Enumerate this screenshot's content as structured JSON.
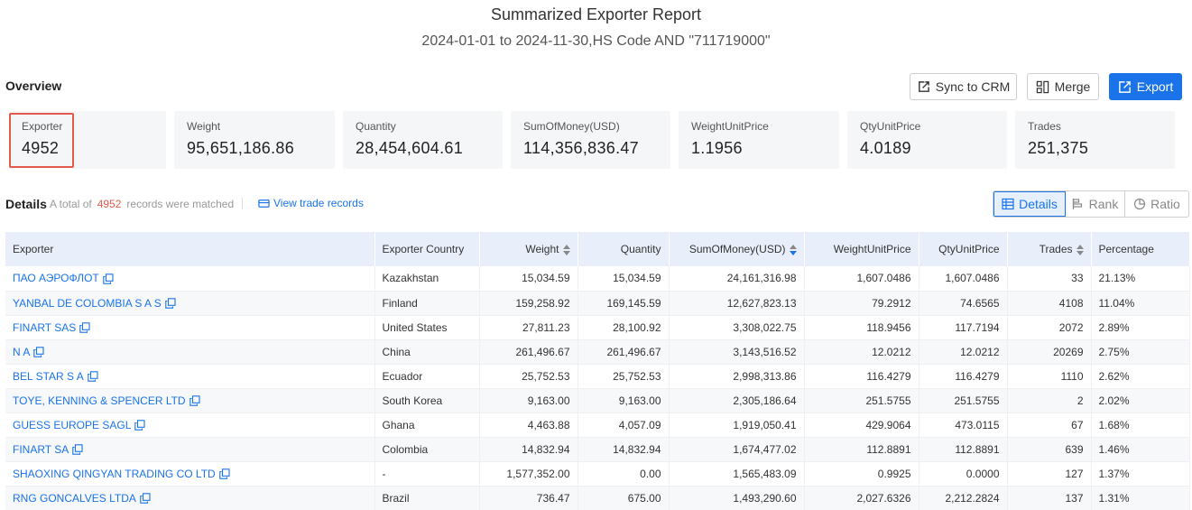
{
  "header": {
    "title": "Summarized Exporter Report",
    "subtitle": "2024-01-01 to 2024-11-30,HS Code AND \"711719000\""
  },
  "overview": {
    "label": "Overview",
    "buttons": {
      "sync": "Sync to CRM",
      "merge": "Merge",
      "export": "Export"
    },
    "stats": [
      {
        "label": "Exporter",
        "value": "4952"
      },
      {
        "label": "Weight",
        "value": "95,651,186.86"
      },
      {
        "label": "Quantity",
        "value": "28,454,604.61"
      },
      {
        "label": "SumOfMoney(USD)",
        "value": "114,356,836.47"
      },
      {
        "label": "WeightUnitPrice",
        "value": "1.1956"
      },
      {
        "label": "QtyUnitPrice",
        "value": "4.0189"
      },
      {
        "label": "Trades",
        "value": "251,375"
      }
    ]
  },
  "details": {
    "label": "Details",
    "meta_prefix": "A total of",
    "count": "4952",
    "meta_suffix": "records were matched",
    "view_link": "View trade records",
    "views": {
      "details": "Details",
      "rank": "Rank",
      "ratio": "Ratio"
    }
  },
  "table": {
    "columns": [
      "Exporter",
      "Exporter Country",
      "Weight",
      "Quantity",
      "SumOfMoney(USD)",
      "WeightUnitPrice",
      "QtyUnitPrice",
      "Trades",
      "Percentage"
    ],
    "rows": [
      [
        "ПАО АЭРОФЛОТ",
        "Kazakhstan",
        "15,034.59",
        "15,034.59",
        "24,161,316.98",
        "1,607.0486",
        "1,607.0486",
        "33",
        "21.13%"
      ],
      [
        "YANBAL DE COLOMBIA S A S",
        "Finland",
        "159,258.92",
        "169,145.59",
        "12,627,823.13",
        "79.2912",
        "74.6565",
        "4108",
        "11.04%"
      ],
      [
        "FINART SAS",
        "United States",
        "27,811.23",
        "28,100.92",
        "3,308,022.75",
        "118.9456",
        "117.7194",
        "2072",
        "2.89%"
      ],
      [
        "N A",
        "China",
        "261,496.67",
        "261,496.67",
        "3,143,516.52",
        "12.0212",
        "12.0212",
        "20269",
        "2.75%"
      ],
      [
        "BEL STAR S A",
        "Ecuador",
        "25,752.53",
        "25,752.53",
        "2,998,313.86",
        "116.4279",
        "116.4279",
        "1110",
        "2.62%"
      ],
      [
        "TOYE, KENNING & SPENCER LTD",
        "South Korea",
        "9,163.00",
        "9,163.00",
        "2,305,186.64",
        "251.5755",
        "251.5755",
        "2",
        "2.02%"
      ],
      [
        "GUESS EUROPE SAGL",
        "Ghana",
        "4,463.88",
        "4,057.09",
        "1,919,050.41",
        "429.9064",
        "473.0115",
        "67",
        "1.68%"
      ],
      [
        "FINART SA",
        "Colombia",
        "14,832.94",
        "14,832.94",
        "1,674,477.02",
        "112.8891",
        "112.8891",
        "639",
        "1.46%"
      ],
      [
        "SHAOXING QINGYAN TRADING CO LTD",
        "-",
        "1,577,352.00",
        "0.00",
        "1,565,483.09",
        "0.9925",
        "0.0000",
        "127",
        "1.37%"
      ],
      [
        "RNG GONCALVES LTDA",
        "Brazil",
        "736.47",
        "675.00",
        "1,493,290.60",
        "2,027.6326",
        "2,212.2824",
        "137",
        "1.31%"
      ]
    ]
  }
}
